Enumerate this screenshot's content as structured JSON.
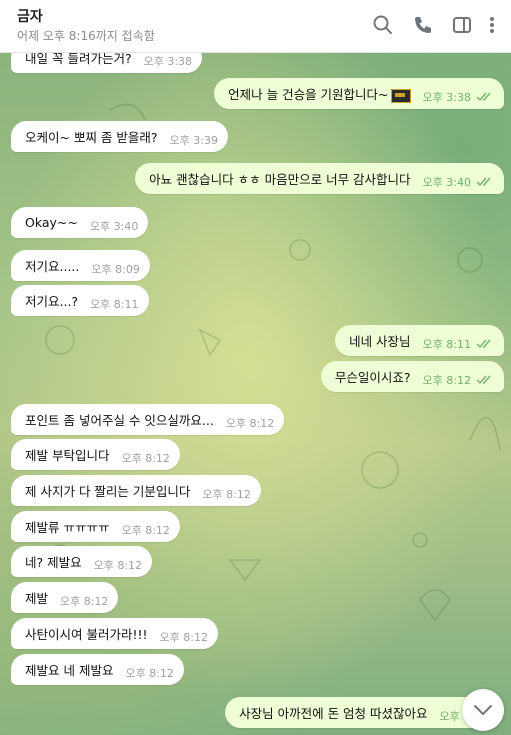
{
  "header": {
    "title": "금자",
    "subtitle": "어제 오후 8:16까지 접속함",
    "icons": [
      "search-icon",
      "phone-icon",
      "sidebar-icon",
      "more-icon"
    ]
  },
  "colors": {
    "incoming_bubble": "#ffffff",
    "outgoing_bubble": "#eefed5",
    "outgoing_meta": "#72b46a",
    "incoming_meta": "#a0a0a0"
  },
  "messages": [
    {
      "dir": "in",
      "text": "내일 꼭 들려가는거?",
      "time": "오후 3:38"
    },
    {
      "dir": "out",
      "text": "언제나 늘 건승을 기원합니다~",
      "time": "오후 3:38",
      "emoji": "flag-icon"
    },
    {
      "dir": "in",
      "text": "오케이~ 뽀찌 좀 받을래?",
      "time": "오후 3:39"
    },
    {
      "dir": "out",
      "text": "아뇨 괜찮습니다 ㅎㅎ 마음만으로 너무 감사합니다",
      "time": "오후 3:40"
    },
    {
      "dir": "in",
      "text": "Okay~~",
      "time": "오후 3:40"
    },
    {
      "dir": "in",
      "text": "저기요.....",
      "time": "오후 8:09"
    },
    {
      "dir": "in",
      "text": "저기요...?",
      "time": "오후 8:11"
    },
    {
      "dir": "out",
      "text": "네네 사장님",
      "time": "오후 8:11"
    },
    {
      "dir": "out",
      "text": "무슨일이시죠?",
      "time": "오후 8:12"
    },
    {
      "dir": "in",
      "text": "포인트 좀 넣어주실 수 잇으실까요...",
      "time": "오후 8:12"
    },
    {
      "dir": "in",
      "text": "제발 부탁입니다",
      "time": "오후 8:12"
    },
    {
      "dir": "in",
      "text": "제 사지가 다 짤리는 기분입니다",
      "time": "오후 8:12"
    },
    {
      "dir": "in",
      "text": "제발류 ㅠㅠㅠㅠ",
      "time": "오후 8:12"
    },
    {
      "dir": "in",
      "text": "네? 제발요",
      "time": "오후 8:12"
    },
    {
      "dir": "in",
      "text": "제발",
      "time": "오후 8:12"
    },
    {
      "dir": "in",
      "text": "사탄이시여 불러가라!!!",
      "time": "오후 8:12"
    },
    {
      "dir": "in",
      "text": "제발요 네 제발요",
      "time": "오후 8:12"
    },
    {
      "dir": "out",
      "text": "사장님 아까전에 돈 엄청 따셨잖아요",
      "time": "오후 8:1"
    }
  ],
  "scroll_button": {
    "icon": "chevron-down-icon"
  }
}
